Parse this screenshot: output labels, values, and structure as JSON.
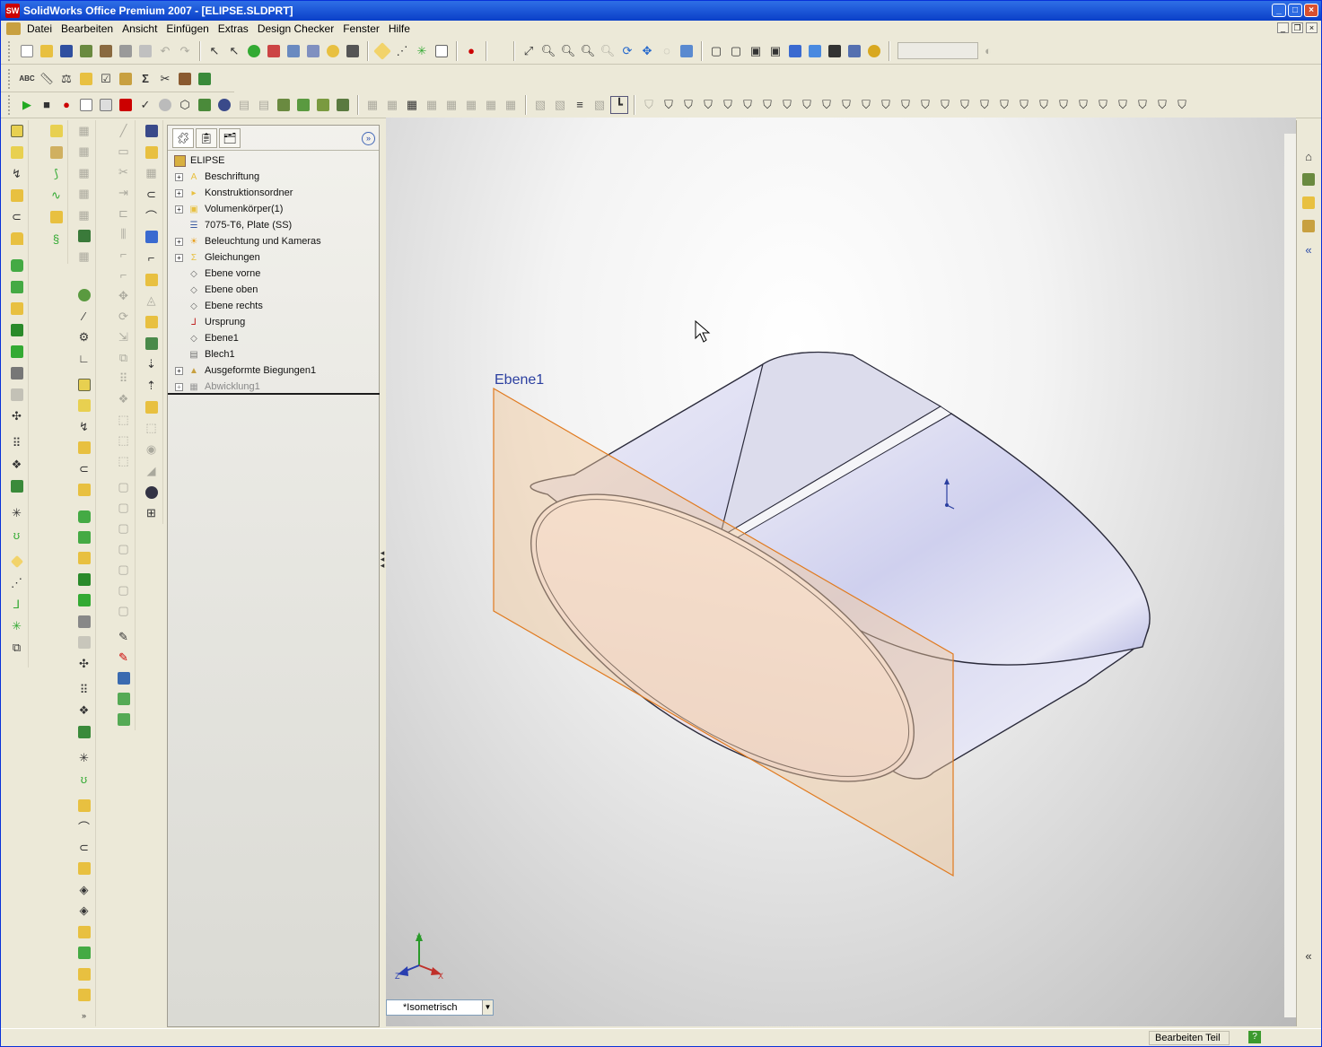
{
  "window": {
    "title": "SolidWorks Office Premium 2007 - [ELIPSE.SLDPRT]",
    "app_icon": "SW"
  },
  "menu": [
    "Datei",
    "Bearbeiten",
    "Ansicht",
    "Einfügen",
    "Extras",
    "Design Checker",
    "Fenster",
    "Hilfe"
  ],
  "feature_manager": {
    "root": "ELIPSE",
    "items": [
      {
        "label": "Beschriftung",
        "expandable": true,
        "icon": "annotation-icon"
      },
      {
        "label": "Konstruktionsordner",
        "expandable": true,
        "icon": "folder-icon"
      },
      {
        "label": "Volumenkörper(1)",
        "expandable": true,
        "icon": "solid-bodies-icon"
      },
      {
        "label": "7075-T6, Plate (SS)",
        "expandable": false,
        "icon": "material-icon"
      },
      {
        "label": "Beleuchtung und Kameras",
        "expandable": true,
        "icon": "lights-icon"
      },
      {
        "label": "Gleichungen",
        "expandable": true,
        "icon": "equations-icon"
      },
      {
        "label": "Ebene vorne",
        "expandable": false,
        "icon": "plane-icon"
      },
      {
        "label": "Ebene oben",
        "expandable": false,
        "icon": "plane-icon"
      },
      {
        "label": "Ebene rechts",
        "expandable": false,
        "icon": "plane-icon"
      },
      {
        "label": "Ursprung",
        "expandable": false,
        "icon": "origin-icon"
      },
      {
        "label": "Ebene1",
        "expandable": false,
        "icon": "plane-icon"
      },
      {
        "label": "Blech1",
        "expandable": false,
        "icon": "sheetmetal-icon"
      },
      {
        "label": "Ausgeformte Biegungen1",
        "expandable": true,
        "icon": "lofted-bend-icon"
      },
      {
        "label": "Abwicklung1",
        "expandable": true,
        "icon": "flatten-icon",
        "suppressed": true
      }
    ]
  },
  "viewport": {
    "plane_label": "Ebene1",
    "view_orientation": "*Isometrisch",
    "triad": {
      "x": "X",
      "y": "Y",
      "z": "Z"
    }
  },
  "status": {
    "mode": "Bearbeiten Teil",
    "help": "?"
  },
  "colors": {
    "plane_edge": "#e07a1f",
    "plane_fill": "#f2c79a",
    "model_edge": "#2a2a3a",
    "title_blue": "#0a3fc8"
  }
}
